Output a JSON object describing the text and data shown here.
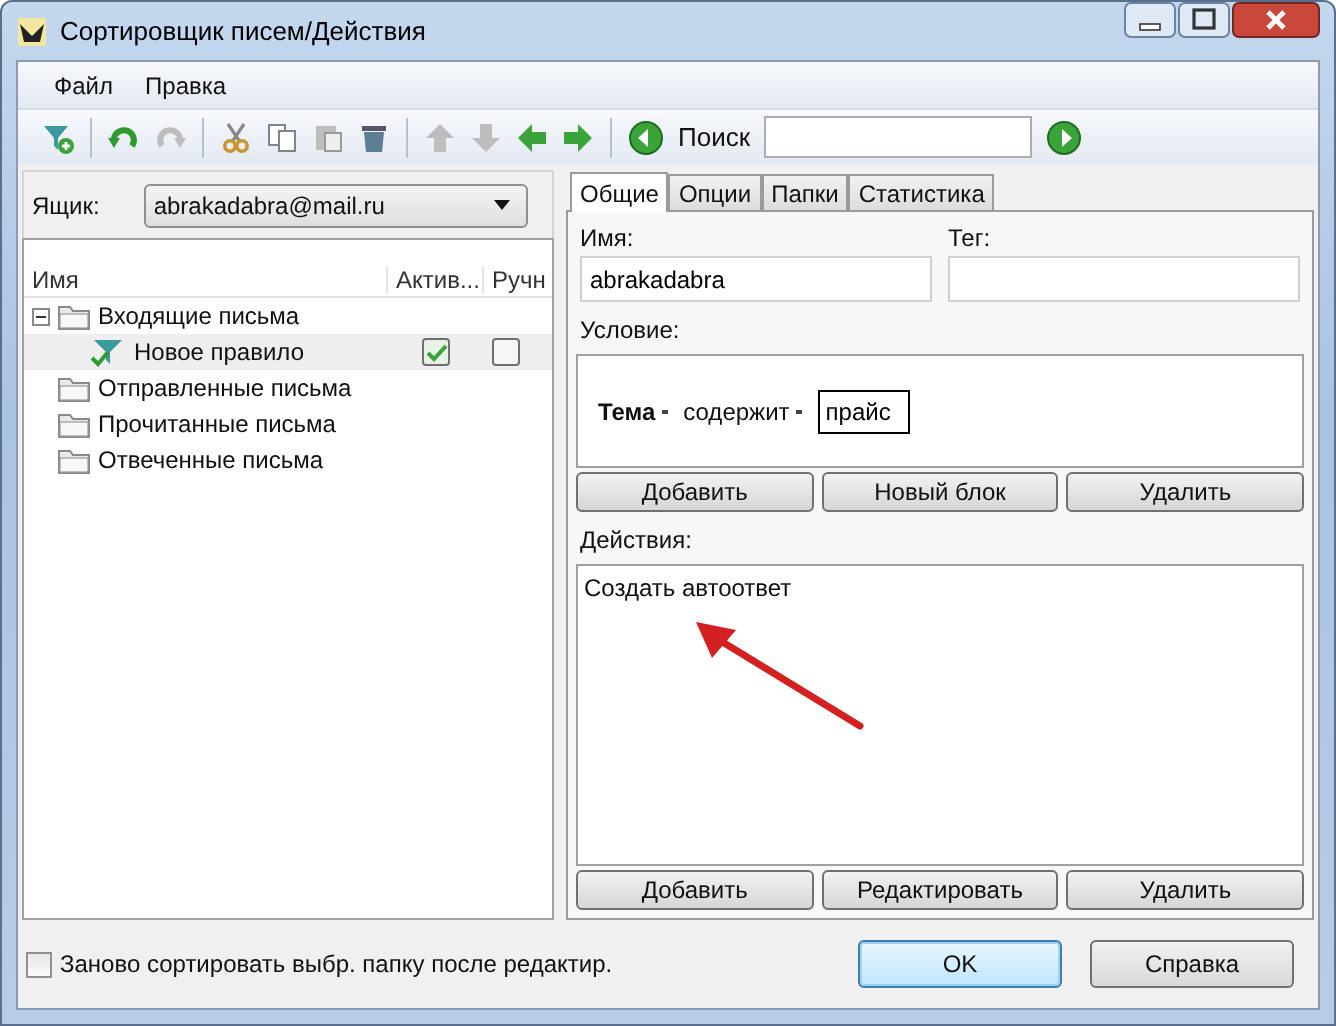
{
  "window": {
    "title": "Сортировщик писем/Действия"
  },
  "menu": [
    "Файл",
    "Правка"
  ],
  "toolbar": {
    "groups": [
      [
        {
          "kind": "add-filter",
          "disabled": false
        }
      ],
      [
        {
          "kind": "undo",
          "disabled": false
        },
        {
          "kind": "redo",
          "disabled": true
        }
      ],
      [
        {
          "kind": "cut",
          "disabled": false
        },
        {
          "kind": "copy",
          "disabled": false
        },
        {
          "kind": "paste",
          "disabled": true
        },
        {
          "kind": "delete",
          "disabled": false
        }
      ],
      [
        {
          "kind": "up",
          "disabled": true
        },
        {
          "kind": "down",
          "disabled": true
        },
        {
          "kind": "left",
          "disabled": false
        },
        {
          "kind": "right",
          "disabled": false
        }
      ]
    ],
    "search_label": "Поиск"
  },
  "mailbox": {
    "label": "Ящик:",
    "value": "abrakadabra@mail.ru"
  },
  "tree": {
    "columns": [
      "Имя",
      "Актив...",
      "Ручн"
    ],
    "items": [
      {
        "kind": "folder",
        "name": "Входящие письма",
        "expanded": true,
        "selected": false,
        "children": [
          {
            "kind": "rule",
            "name": "Новое правило",
            "active": true,
            "manual": false,
            "selected": true
          }
        ]
      },
      {
        "kind": "folder",
        "name": "Отправленные письма",
        "selected": false
      },
      {
        "kind": "folder",
        "name": "Прочитанные письма",
        "selected": false
      },
      {
        "kind": "folder",
        "name": "Отвеченные письма",
        "selected": false
      }
    ]
  },
  "tabs": [
    {
      "label": "Общие",
      "selected": true
    },
    {
      "label": "Опции",
      "selected": false
    },
    {
      "label": "Папки",
      "selected": false
    },
    {
      "label": "Статистика",
      "selected": false
    }
  ],
  "name_field": {
    "label": "Имя:",
    "value": "abrakadabra"
  },
  "tag_field": {
    "label": "Тег:"
  },
  "condition": {
    "label": "Условие:",
    "field": "Тема",
    "operator": "содержит",
    "value": "прайс"
  },
  "condition_buttons": [
    "Добавить",
    "Новый блок",
    "Удалить"
  ],
  "actions": {
    "label": "Действия:",
    "items": [
      "Создать автоответ"
    ]
  },
  "action_buttons": [
    "Добавить",
    "Редактировать",
    "Удалить"
  ],
  "resort": {
    "label": "Заново сортировать выбр. папку после редактир.",
    "checked": false
  },
  "buttons": [
    {
      "label": "OK",
      "default": true
    },
    {
      "label": "Справка",
      "default": false
    }
  ]
}
